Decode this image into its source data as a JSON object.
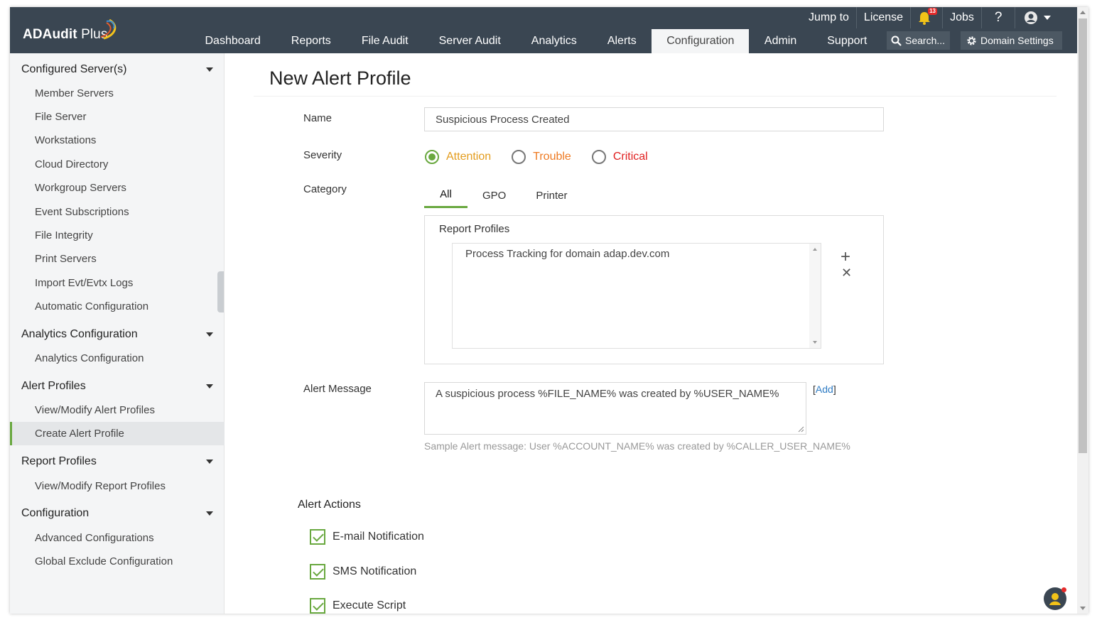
{
  "app": {
    "name": "ADAudit Plus",
    "logo_main": "ADAudit",
    "logo_suffix": "Plus"
  },
  "header": {
    "utility": {
      "jump_to": "Jump to",
      "license": "License",
      "notification_count": "13",
      "jobs": "Jobs",
      "help": "?"
    },
    "nav": [
      {
        "label": "Dashboard",
        "active": false
      },
      {
        "label": "Reports",
        "active": false
      },
      {
        "label": "File Audit",
        "active": false
      },
      {
        "label": "Server Audit",
        "active": false
      },
      {
        "label": "Analytics",
        "active": false
      },
      {
        "label": "Alerts",
        "active": false
      },
      {
        "label": "Configuration",
        "active": true
      },
      {
        "label": "Admin",
        "active": false
      },
      {
        "label": "Support",
        "active": false
      }
    ],
    "search_placeholder": "Search...",
    "domain_settings": "Domain Settings"
  },
  "sidebar": {
    "sections": [
      {
        "title": "Configured Server(s)",
        "items": [
          "Member Servers",
          "File Server",
          "Workstations",
          "Cloud Directory",
          "Workgroup Servers",
          "Event Subscriptions",
          "File Integrity",
          "Print Servers",
          "Import Evt/Evtx Logs",
          "Automatic Configuration"
        ]
      },
      {
        "title": "Analytics Configuration",
        "items": [
          "Analytics Configuration"
        ]
      },
      {
        "title": "Alert Profiles",
        "items": [
          "View/Modify Alert Profiles",
          "Create Alert Profile"
        ]
      },
      {
        "title": "Report Profiles",
        "items": [
          "View/Modify Report Profiles"
        ]
      },
      {
        "title": "Configuration",
        "items": [
          "Advanced Configurations",
          "Global Exclude Configuration"
        ]
      }
    ],
    "active_item": "Create Alert Profile"
  },
  "form": {
    "page_title": "New Alert Profile",
    "name_label": "Name",
    "name_value": "Suspicious Process Created",
    "severity_label": "Severity",
    "severity_options": [
      {
        "label": "Attention",
        "color": "#e39c1d",
        "selected": true
      },
      {
        "label": "Trouble",
        "color": "#ee7a22",
        "selected": false
      },
      {
        "label": "Critical",
        "color": "#e02020",
        "selected": false
      }
    ],
    "category_label": "Category",
    "category_tabs": [
      {
        "label": "All",
        "active": true
      },
      {
        "label": "GPO",
        "active": false
      },
      {
        "label": "Printer",
        "active": false
      }
    ],
    "report_profiles_label": "Report Profiles",
    "report_profiles": [
      "Process Tracking for domain adap.dev.com"
    ],
    "add_symbol": "+",
    "remove_symbol": "✕",
    "alert_message_label": "Alert Message",
    "alert_message_value": "A suspicious process %FILE_NAME% was created by %USER_NAME%",
    "add_link_open": "[",
    "add_link": "Add",
    "add_link_close": "]",
    "sample_message": "Sample Alert message: User %ACCOUNT_NAME% was created by %CALLER_USER_NAME%",
    "alert_actions_title": "Alert Actions",
    "alert_actions": [
      {
        "label": "E-mail Notification",
        "checked": true
      },
      {
        "label": "SMS Notification",
        "checked": true
      },
      {
        "label": "Execute Script",
        "checked": true
      }
    ]
  },
  "colors": {
    "accent_green": "#69a83f",
    "header_bg": "#3a4652",
    "link_blue": "#2f7cc4"
  }
}
